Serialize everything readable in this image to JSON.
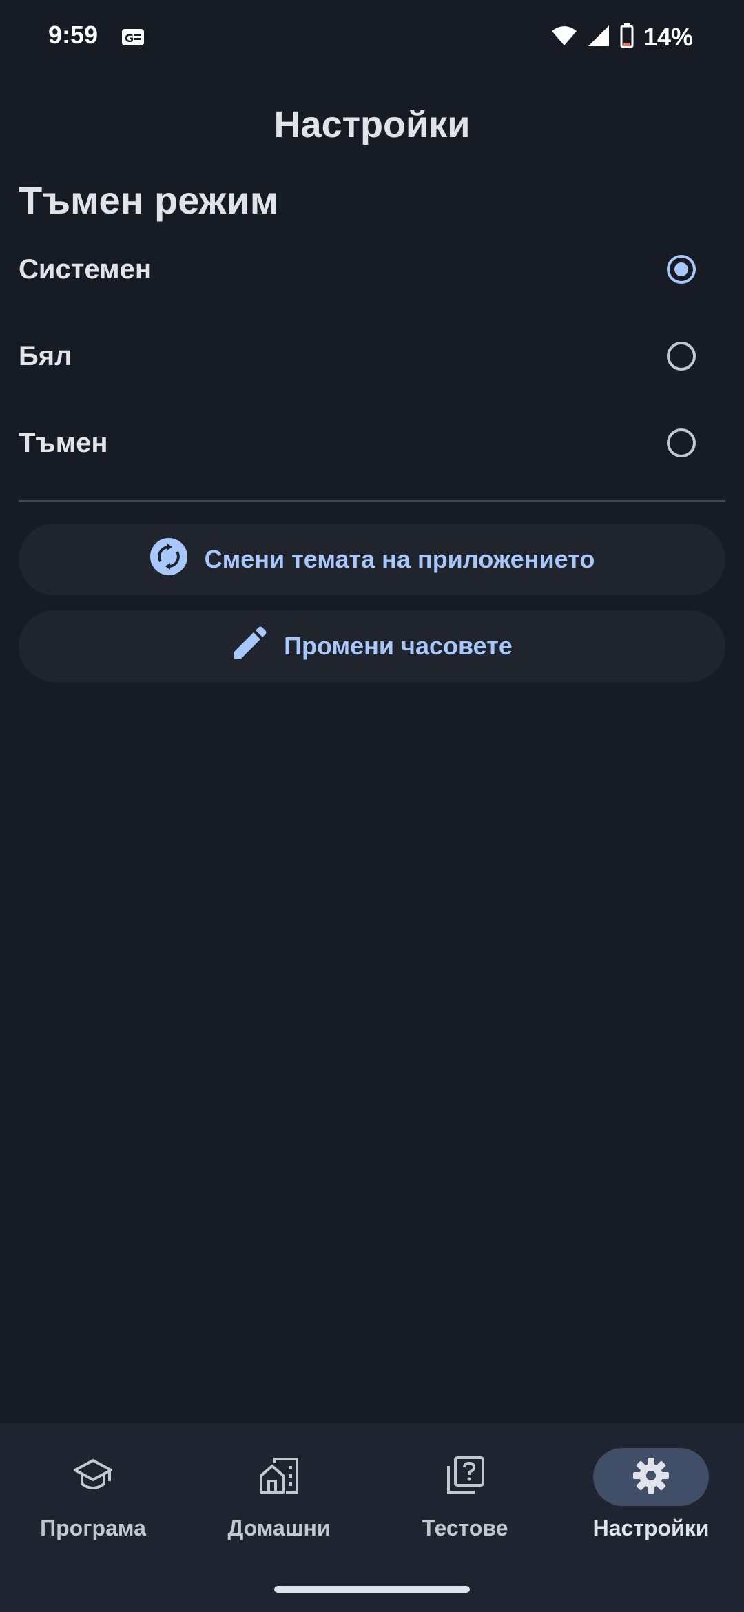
{
  "status_bar": {
    "time": "9:59",
    "battery_percent": "14%",
    "icons": [
      "notification-card-icon",
      "wifi-icon",
      "signal-icon",
      "battery-icon"
    ]
  },
  "page": {
    "title": "Настройки"
  },
  "dark_mode": {
    "section_title": "Тъмен режим",
    "options": [
      {
        "label": "Системен",
        "selected": true
      },
      {
        "label": "Бял",
        "selected": false
      },
      {
        "label": "Тъмен",
        "selected": false
      }
    ]
  },
  "actions": {
    "change_theme_label": "Смени темата на приложението",
    "change_theme_icon": "sync-icon",
    "edit_hours_label": "Промени часовете",
    "edit_hours_icon": "pencil-icon"
  },
  "bottom_nav": {
    "items": [
      {
        "label": "Програма",
        "icon": "school-icon",
        "active": false
      },
      {
        "label": "Домашни",
        "icon": "home-work-icon",
        "active": false
      },
      {
        "label": "Тестове",
        "icon": "quiz-icon",
        "active": false
      },
      {
        "label": "Настройки",
        "icon": "gear-icon",
        "active": true
      }
    ]
  },
  "colors": {
    "background": "#171c24",
    "accent": "#a8c8fb",
    "surface": "#1f242d",
    "nav_background": "#1f2530",
    "nav_active_pill": "#414e68"
  }
}
